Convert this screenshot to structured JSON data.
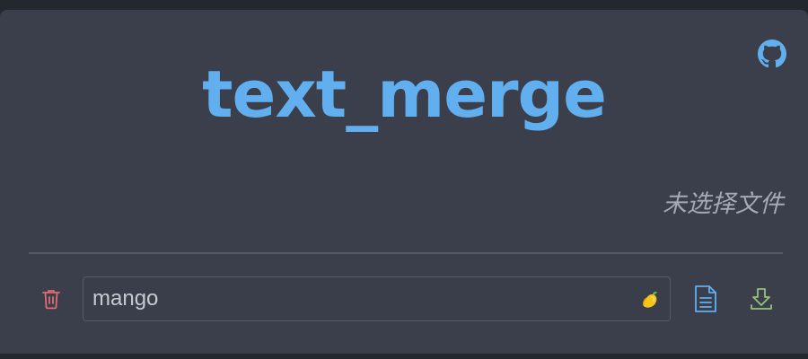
{
  "app": {
    "title": "text_merge",
    "file_status": "未选择文件"
  },
  "input": {
    "value": "mango",
    "icon": "mango-emoji-icon"
  },
  "icons": {
    "github": "github-icon",
    "delete": "trash-icon",
    "file": "file-text-icon",
    "download": "download-icon"
  },
  "colors": {
    "background": "#3a3f4b",
    "accent": "#61afef",
    "danger": "#e06c75",
    "success": "#98c379",
    "muted_text": "#a4a9b3"
  }
}
